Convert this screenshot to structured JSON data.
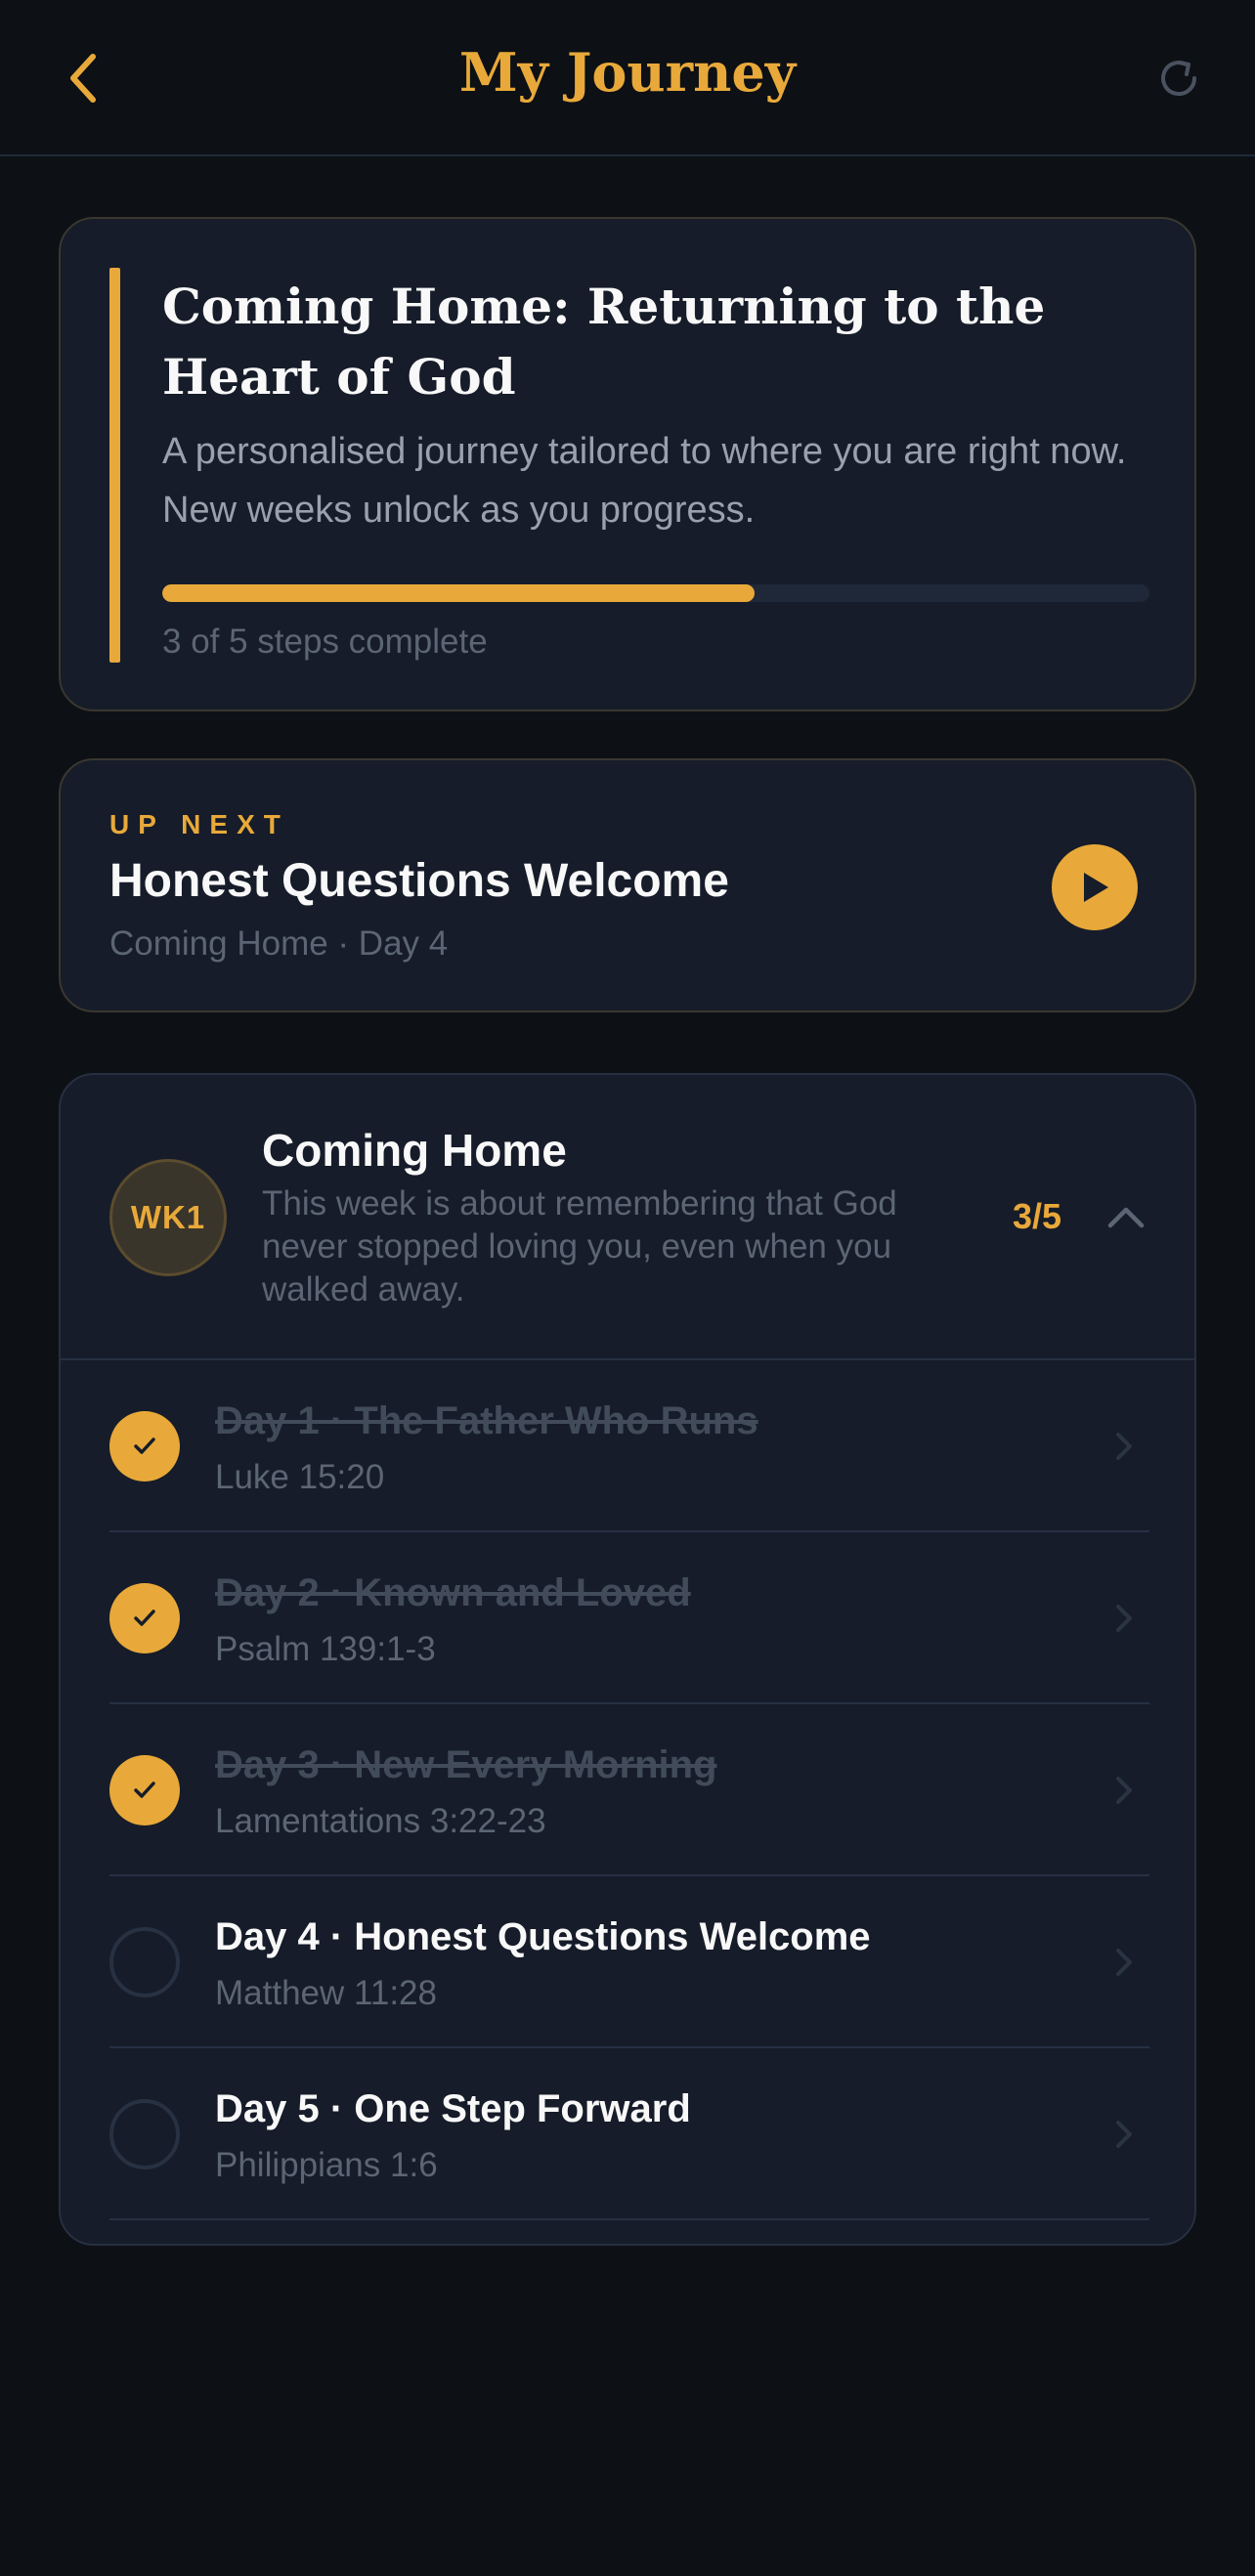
{
  "header": {
    "title": "My Journey",
    "back_icon": "chevron-left-icon",
    "refresh_icon": "refresh-icon"
  },
  "journey": {
    "title": "Coming Home: Returning to the Heart of God",
    "description": "A personalised journey tailored to where you are right now. New weeks unlock as you progress.",
    "progress_fraction": 0.6,
    "progress_text": "3 of 5 steps complete"
  },
  "up_next": {
    "kicker": "UP NEXT",
    "title": "Honest Questions Welcome",
    "subtitle": "Coming Home · Day 4",
    "play_icon": "play-icon"
  },
  "week": {
    "badge": "WK1",
    "title": "Coming Home",
    "description": "This week is about remembering that God never stopped loving you, even when you walked away.",
    "count": "3/5",
    "expanded": true,
    "days": [
      {
        "title": "Day 1 · The Father Who Runs",
        "reference": "Luke 15:20",
        "completed": true
      },
      {
        "title": "Day 2 · Known and Loved",
        "reference": "Psalm 139:1-3",
        "completed": true
      },
      {
        "title": "Day 3 · New Every Morning",
        "reference": "Lamentations 3:22-23",
        "completed": true
      },
      {
        "title": "Day 4 · Honest Questions Welcome",
        "reference": "Matthew 11:28",
        "completed": false
      },
      {
        "title": "Day 5 · One Step Forward",
        "reference": "Philippians 1:6",
        "completed": false
      }
    ]
  },
  "colors": {
    "accent": "#e8a93a",
    "background": "#0d1015",
    "card": "#161c29",
    "muted_text": "#5c6573"
  }
}
